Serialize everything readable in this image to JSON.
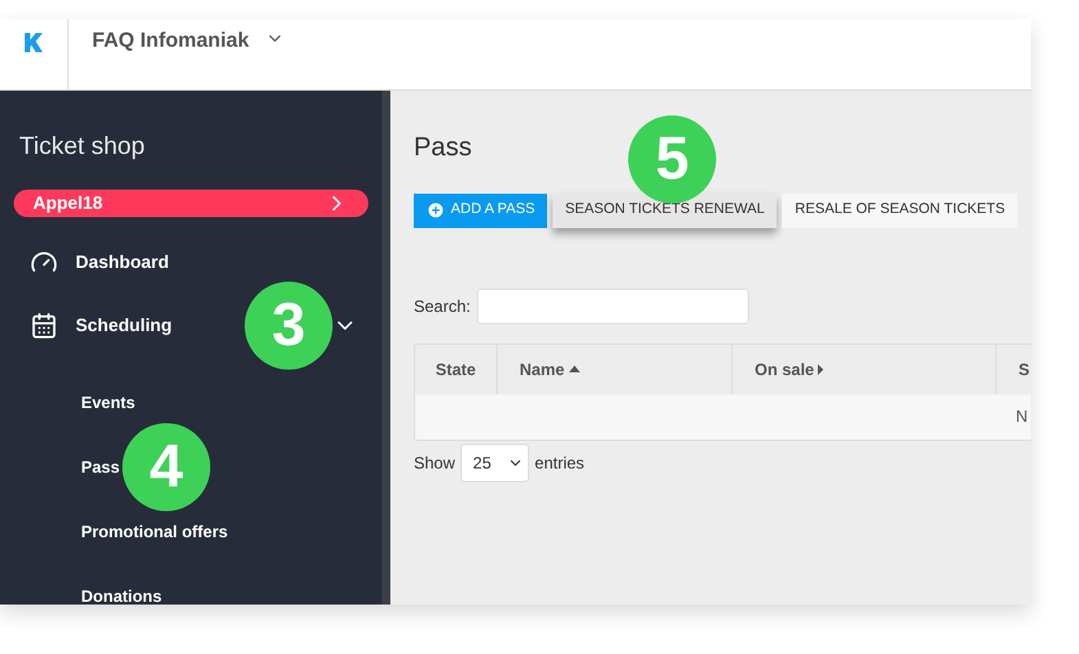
{
  "header": {
    "title": "FAQ Infomaniak"
  },
  "sidebar": {
    "title": "Ticket shop",
    "project": {
      "label": "Appel18"
    },
    "items": [
      {
        "label": "Dashboard",
        "kind": "gauge"
      },
      {
        "label": "Scheduling",
        "kind": "calendar",
        "expanded": true,
        "marker": "3",
        "children": [
          {
            "label": "Events"
          },
          {
            "label": "Pass",
            "marker": "4"
          },
          {
            "label": "Promotional offers"
          },
          {
            "label": "Donations"
          }
        ]
      }
    ]
  },
  "main": {
    "title": "Pass",
    "buttons": [
      {
        "label": "ADD A PASS",
        "kind": "primary"
      },
      {
        "label": "SEASON TICKETS RENEWAL",
        "kind": "highlighted",
        "marker": "5"
      },
      {
        "label": "RESALE OF SEASON TICKETS",
        "kind": "default"
      }
    ],
    "search": {
      "label": "Search:"
    },
    "table": {
      "columns": [
        {
          "label": "State",
          "kind": "plain"
        },
        {
          "label": "Name",
          "kind": "sorted_asc"
        },
        {
          "label": "On sale",
          "kind": "sortable"
        },
        {
          "label": "S",
          "kind": "plain"
        }
      ],
      "rows": [
        [
          "",
          "",
          "",
          "N"
        ]
      ]
    },
    "length": {
      "before": "Show",
      "value": "25",
      "after": "entries"
    }
  }
}
